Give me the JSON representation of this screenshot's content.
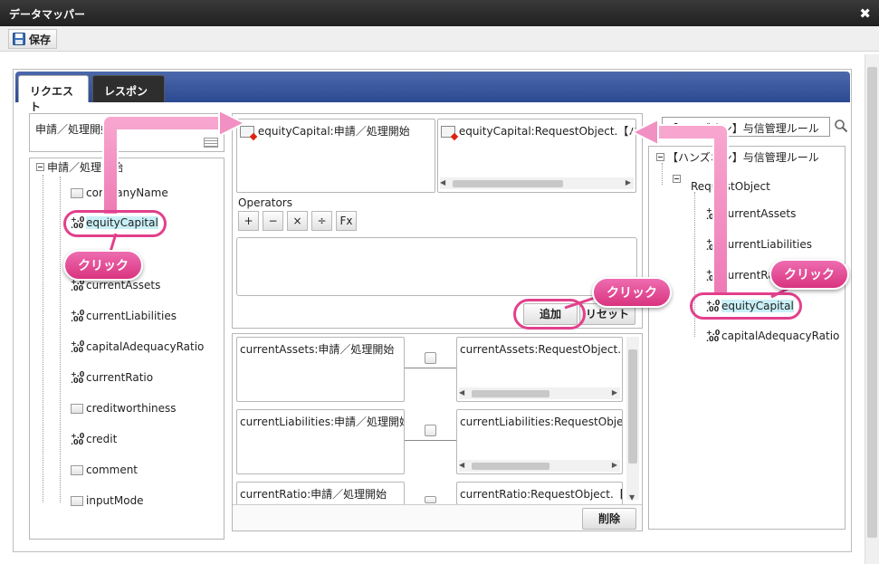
{
  "window": {
    "title": "データマッパー"
  },
  "toolbar": {
    "save_label": "保存"
  },
  "tabs": [
    {
      "label": "リクエスト"
    },
    {
      "label": "レスポンス"
    }
  ],
  "left": {
    "header": "申請／処理開始",
    "tree_root": "申請／処理開始",
    "items": [
      {
        "label": "companyName",
        "type": "folder"
      },
      {
        "label": "equityCapital",
        "type": "number"
      },
      {
        "label": "currentAssets",
        "type": "number"
      },
      {
        "label": "currentLiabilities",
        "type": "number"
      },
      {
        "label": "capitalAdequacyRatio",
        "type": "number"
      },
      {
        "label": "currentRatio",
        "type": "number"
      },
      {
        "label": "creditworthiness",
        "type": "folder"
      },
      {
        "label": "credit",
        "type": "number"
      },
      {
        "label": "comment",
        "type": "folder"
      },
      {
        "label": "inputMode",
        "type": "folder"
      }
    ]
  },
  "middle": {
    "source_box": "equityCapital:申請／処理開始",
    "target_box": "equityCapital:RequestObject.【ハンズ",
    "operators_label": "Operators",
    "operators": [
      "+",
      "−",
      "×",
      "÷",
      "Fx"
    ],
    "add_button": "追加",
    "reset_button": "リセット",
    "delete_button": "削除",
    "mappings": [
      {
        "source": "currentAssets:申請／処理開始",
        "target": "currentAssets:RequestObject.【ハ"
      },
      {
        "source": "currentLiabilities:申請／処理開始",
        "target": "currentLiabilities:RequestObject.【"
      },
      {
        "source": "currentRatio:申請／処理開始",
        "target": "currentRatio:RequestObject.【ハン"
      }
    ]
  },
  "right": {
    "search_value": "【ハンズオン】与信管理ルール",
    "tree_root": "【ハンズオン】与信管理ルール",
    "object": "RequestObject",
    "items": [
      {
        "label": "currentAssets"
      },
      {
        "label": "currentLiabilities"
      },
      {
        "label": "currentRatio"
      },
      {
        "label": "equityCapital"
      },
      {
        "label": "capitalAdequacyRatio"
      }
    ]
  },
  "callouts": {
    "click_left": "クリック",
    "click_add": "クリック",
    "click_right": "クリック"
  },
  "colors": {
    "callout": "#e2408c",
    "tabbar": "#2c4a92",
    "titlebar": "#2a2a2a",
    "highlight": "#c9f0f7"
  },
  "icons": {
    "close": "close-icon",
    "save": "floppy-icon",
    "search": "search-icon"
  }
}
